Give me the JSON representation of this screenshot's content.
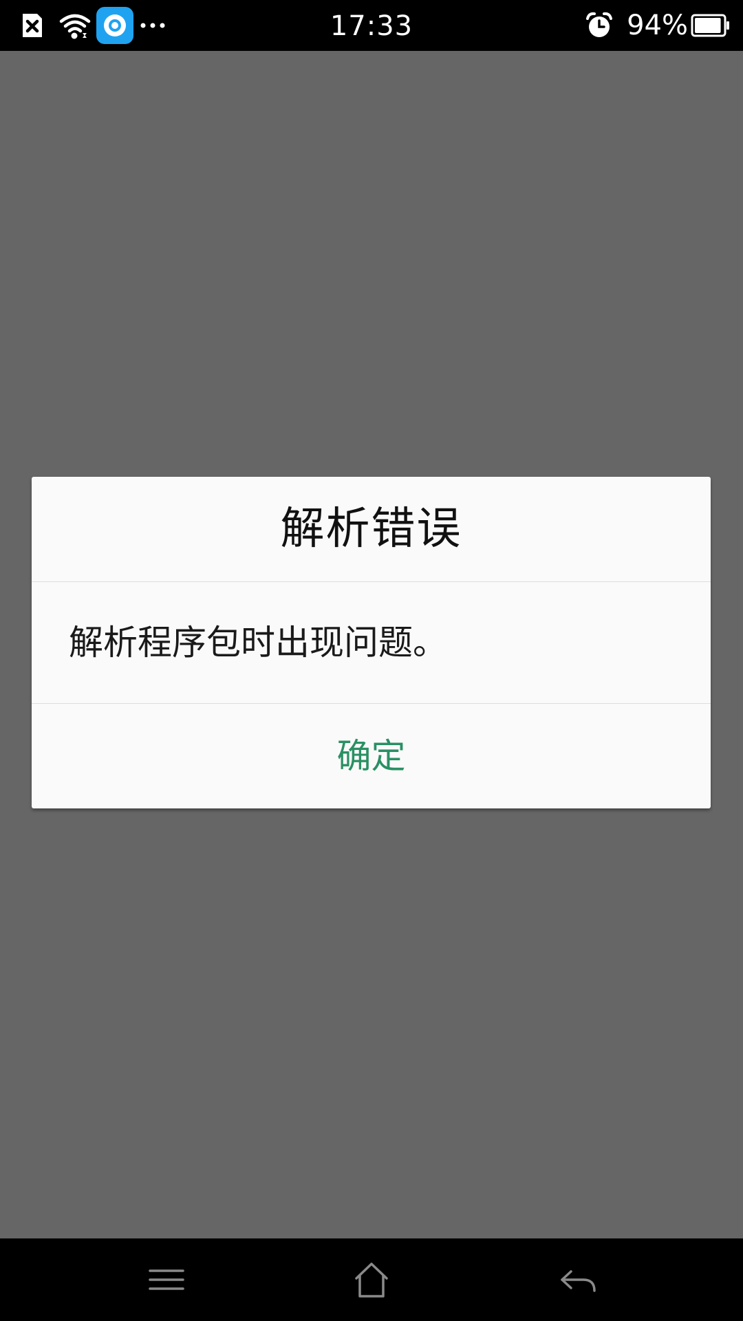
{
  "status_bar": {
    "time": "17:33",
    "battery_percent": "94%",
    "battery_level": 0.94,
    "left_icons": [
      "notification-x-icon",
      "wifi-icon",
      "app-notification-icon",
      "more-dots-icon"
    ],
    "right_icons": [
      "alarm-icon",
      "battery-icon"
    ]
  },
  "dialog": {
    "title": "解析错误",
    "message": "解析程序包时出现问题。",
    "confirm_label": "确定"
  },
  "nav_bar": {
    "icons": [
      "menu-icon",
      "home-icon",
      "back-icon"
    ]
  },
  "colors": {
    "scrim": "#666666",
    "dialog_background": "#fafafa",
    "confirm_text": "#2a9063",
    "app_icon_blue": "#1fa3f0"
  }
}
